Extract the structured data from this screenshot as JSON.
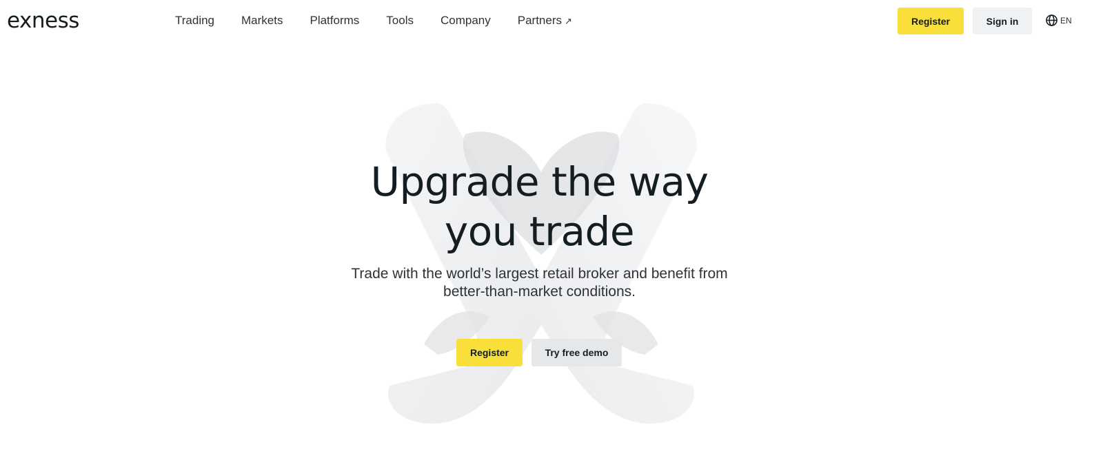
{
  "header": {
    "logo": "exness",
    "nav": [
      {
        "label": "Trading"
      },
      {
        "label": "Markets"
      },
      {
        "label": "Platforms"
      },
      {
        "label": "Tools"
      },
      {
        "label": "Company"
      },
      {
        "label": "Partners",
        "external_icon": "↗"
      }
    ],
    "register_label": "Register",
    "signin_label": "Sign in",
    "language": {
      "icon": "globe-icon",
      "label": "EN"
    }
  },
  "hero": {
    "title_line1": "Upgrade the way",
    "title_line2": "you trade",
    "subtitle_line1": "Trade with the world’s largest retail broker and benefit from",
    "subtitle_line2": "better-than-market conditions.",
    "register_label": "Register",
    "demo_label": "Try free demo"
  },
  "colors": {
    "accent": "#f8df3a",
    "secondary_button": "#f1f2f4",
    "text": "#141d22"
  }
}
